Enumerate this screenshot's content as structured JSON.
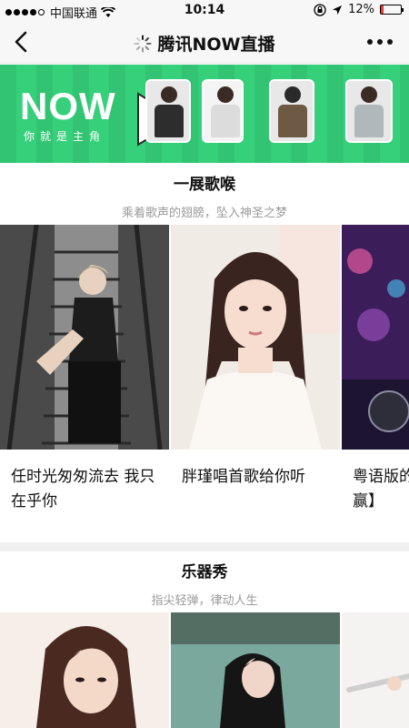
{
  "status_bar": {
    "carrier": "中国联通",
    "time": "10:14",
    "battery": "12%",
    "battery_level": 0.12
  },
  "nav": {
    "title": "腾讯NOW直播"
  },
  "banner": {
    "logo": "NOW",
    "slogan": "你就是主角"
  },
  "sections": [
    {
      "title": "一展歌喉",
      "subtitle": "乘着歌声的翅膀，坠入神圣之梦",
      "cards": [
        {
          "title": "任时光匆匆流去 我只在乎你"
        },
        {
          "title": "胖瑾唱首歌给你听"
        },
        {
          "title": "粤语版的赢】"
        }
      ]
    },
    {
      "title": "乐器秀",
      "subtitle": "指尖轻弹，律动人生",
      "cards": [
        {
          "title": ""
        },
        {
          "title": ""
        },
        {
          "title": ""
        }
      ]
    }
  ],
  "icons": {
    "back": "chevron-left-icon",
    "more": "more-dots-icon",
    "wifi": "wifi-icon",
    "location": "location-arrow-icon",
    "lock_rotation": "rotation-lock-icon",
    "loading": "loading-spinner-icon"
  },
  "colors": {
    "banner_green": "#36d07b",
    "battery_low": "#e43b2e"
  }
}
